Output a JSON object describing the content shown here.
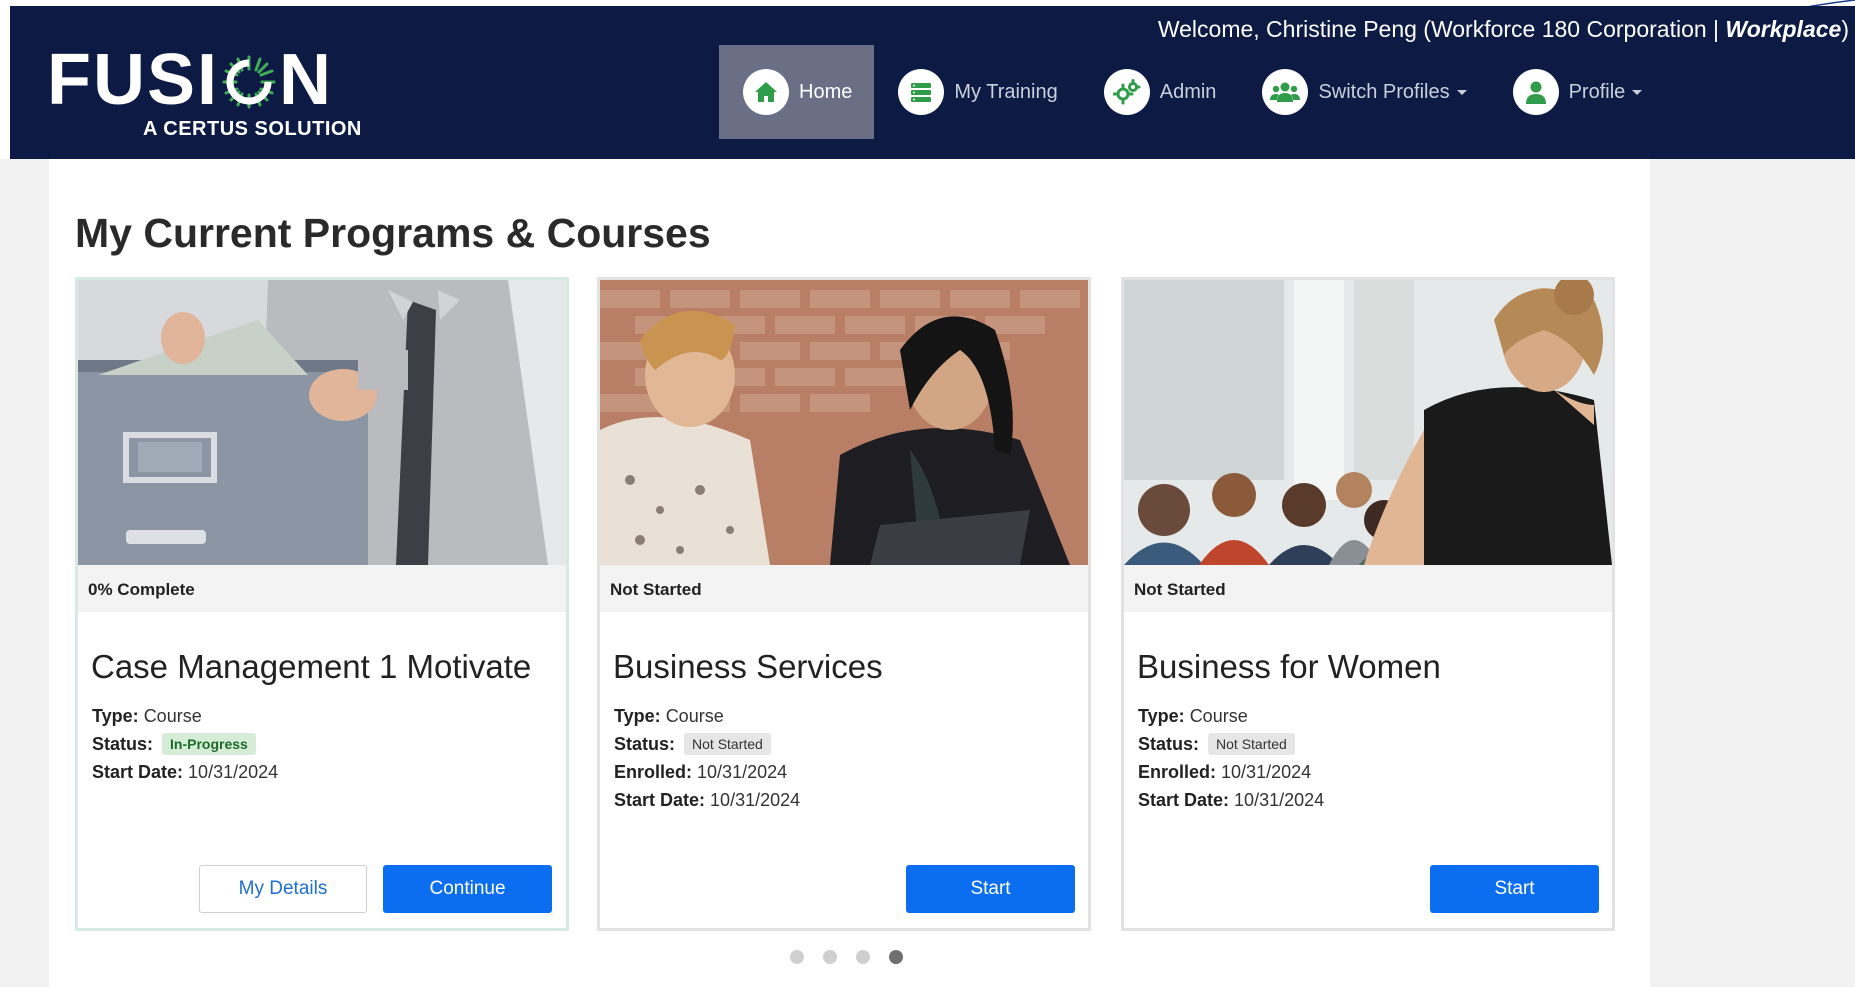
{
  "header": {
    "brand": {
      "word_left": "FUSI",
      "word_right": "N",
      "tagline": "A CERTUS SOLUTION"
    },
    "welcome": {
      "prefix": "Welcome, Christine Peng (Workforce 180 Corporation | ",
      "role": "Workplace",
      "suffix": ")"
    },
    "nav": [
      {
        "label": "Home",
        "icon": "home-icon",
        "active": true
      },
      {
        "label": "My Training",
        "icon": "training-list-icon"
      },
      {
        "label": "Admin",
        "icon": "gears-icon"
      },
      {
        "label": "Switch Profiles",
        "icon": "users-group-icon",
        "dropdown": true
      },
      {
        "label": "Profile",
        "icon": "user-icon",
        "dropdown": true
      }
    ]
  },
  "page": {
    "title": "My Current Programs & Courses"
  },
  "cards": [
    {
      "image": "man-opening-file-cabinet-photo",
      "progress": "0% Complete",
      "title": "Case Management 1 Motivate",
      "type_label": "Type:",
      "type": "Course",
      "status_label": "Status:",
      "status": "In-Progress",
      "start_label": "Start Date:",
      "start_date": "10/31/2024",
      "buttons": [
        "My Details",
        "Continue"
      ]
    },
    {
      "image": "two-women-meeting-photo",
      "progress": "Not Started",
      "title": "Business Services",
      "type_label": "Type:",
      "type": "Course",
      "status_label": "Status:",
      "status": "Not Started",
      "enrolled_label": "Enrolled:",
      "enrolled": "10/31/2024",
      "start_label": "Start Date:",
      "start_date": "10/31/2024",
      "buttons": [
        "Start"
      ]
    },
    {
      "image": "woman-presenting-to-audience-photo",
      "progress": "Not Started",
      "title": "Business for Women",
      "type_label": "Type:",
      "type": "Course",
      "status_label": "Status:",
      "status": "Not Started",
      "enrolled_label": "Enrolled:",
      "enrolled": "10/31/2024",
      "start_label": "Start Date:",
      "start_date": "10/31/2024",
      "buttons": [
        "Start"
      ]
    }
  ],
  "carousel": {
    "pages": 4,
    "current": 4
  },
  "colors": {
    "navbar": "#0c1a44",
    "nav_active": "#6b6f86",
    "primary_button": "#0b6ef0",
    "status_green": "#1f6b2a",
    "nav_icon_green": "#2e9c48"
  }
}
